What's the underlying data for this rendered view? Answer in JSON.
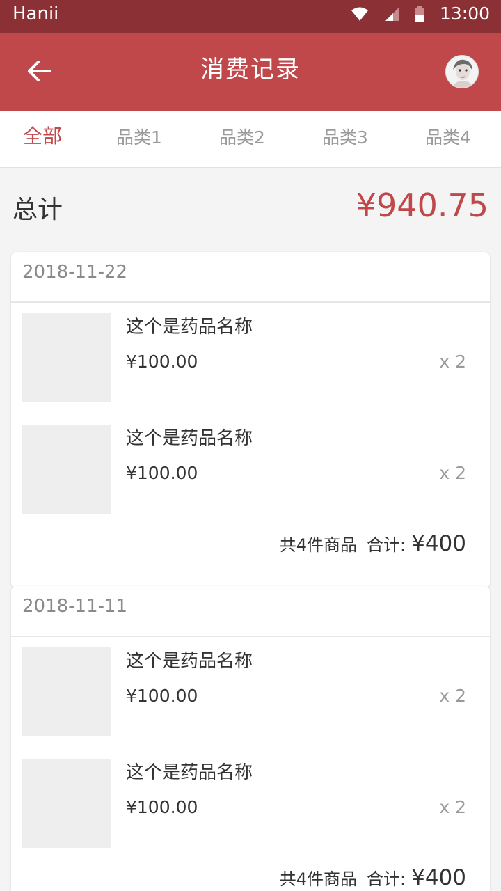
{
  "status_bar": {
    "carrier": "Hanii",
    "time": "13:00"
  },
  "header": {
    "title": "消费记录"
  },
  "tabs": [
    {
      "label": "全部",
      "active": true
    },
    {
      "label": "品类1",
      "active": false
    },
    {
      "label": "品类2",
      "active": false
    },
    {
      "label": "品类3",
      "active": false
    },
    {
      "label": "品类4",
      "active": false
    }
  ],
  "summary": {
    "label": "总计",
    "amount": "¥940.75"
  },
  "records": [
    {
      "date": "2018-11-22",
      "items": [
        {
          "name": "这个是药品名称",
          "price": "¥100.00",
          "qty": "x 2"
        },
        {
          "name": "这个是药品名称",
          "price": "¥100.00",
          "qty": "x 2"
        }
      ],
      "count_text": "共4件商品",
      "sum_label": "合计:",
      "sum": "¥400"
    },
    {
      "date": "2018-11-11",
      "items": [
        {
          "name": "这个是药品名称",
          "price": "¥100.00",
          "qty": "x 2"
        },
        {
          "name": "这个是药品名称",
          "price": "¥100.00",
          "qty": "x 2"
        }
      ],
      "count_text": "共4件商品",
      "sum_label": "合计:",
      "sum": "¥400"
    }
  ],
  "colors": {
    "accent": "#c0484a",
    "status_bar": "#8b3034",
    "background": "#f4f4f4"
  }
}
